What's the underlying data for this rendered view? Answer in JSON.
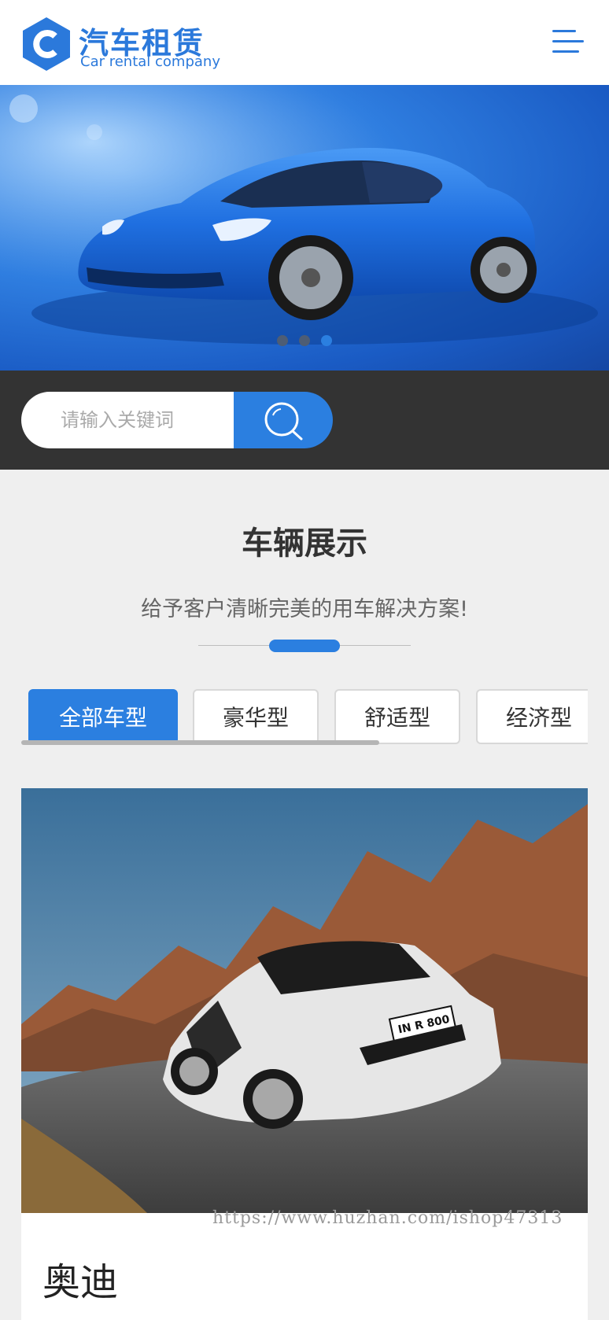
{
  "header": {
    "logo_title": "汽车租赁",
    "logo_subtitle": "Car rental company",
    "logo_letter": "C",
    "menu_icon": "hamburger-menu-icon"
  },
  "banner": {
    "slide_count": 3,
    "active_slide": 3
  },
  "search": {
    "placeholder": "请输入关键词",
    "button_icon": "search-icon"
  },
  "section": {
    "title": "车辆展示",
    "subtitle": "给予客户清晰完美的用车解决方案!"
  },
  "tabs": [
    {
      "label": "全部车型",
      "active": true
    },
    {
      "label": "豪华型",
      "active": false
    },
    {
      "label": "舒适型",
      "active": false
    },
    {
      "label": "经济型",
      "active": false
    }
  ],
  "product": {
    "title": "奥迪",
    "plate_text": "IN R 800"
  },
  "watermark": "https://www.huzhan.com/ishop47313",
  "colors": {
    "accent": "#2b7fe0",
    "dark_bar": "#333333",
    "page_bg": "#efefef"
  }
}
